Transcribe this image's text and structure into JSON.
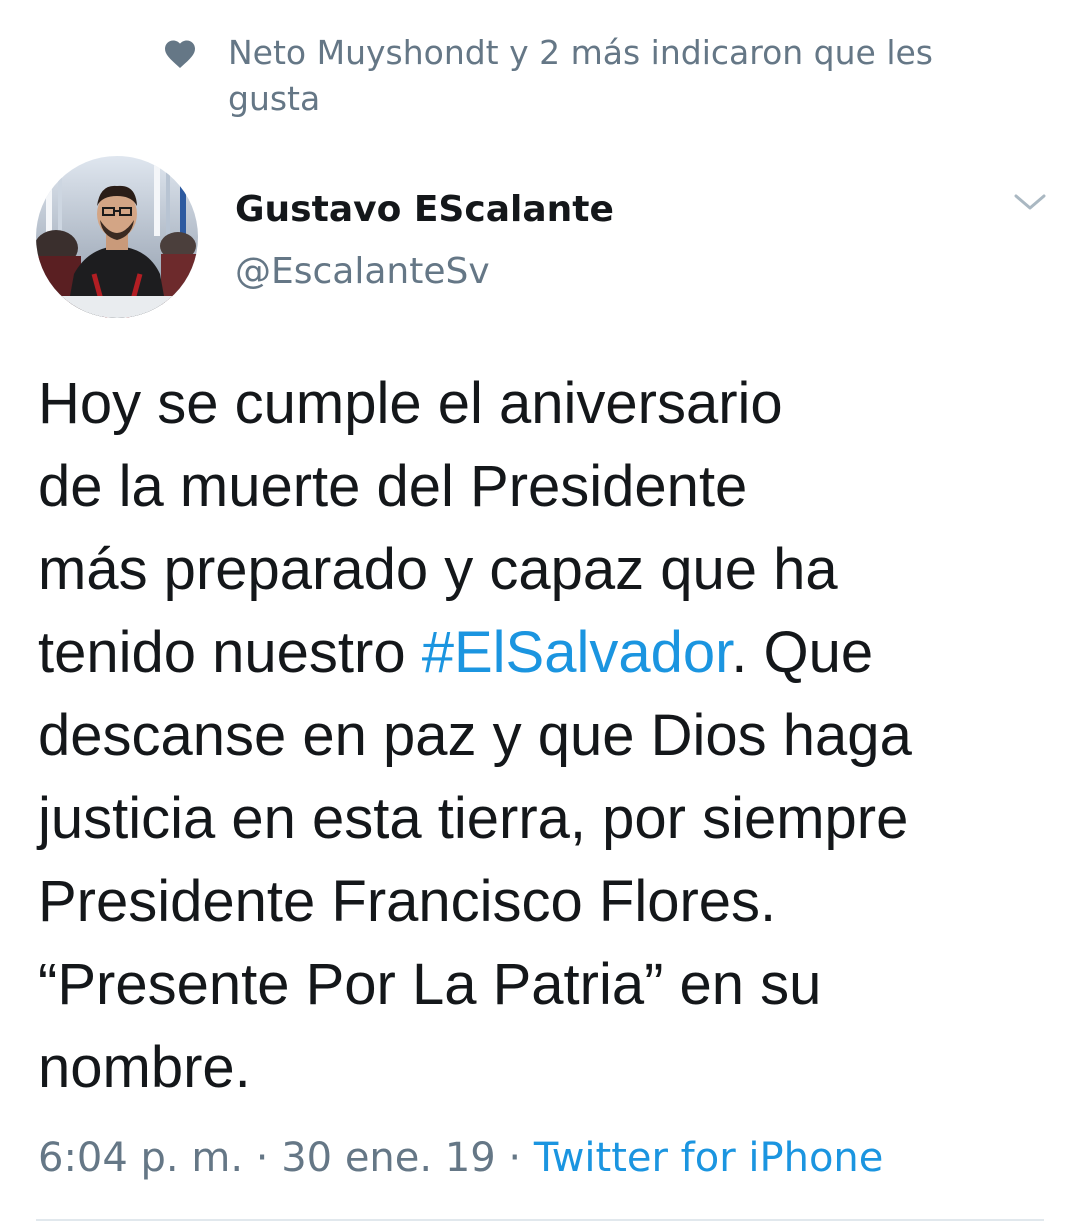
{
  "social_context": {
    "icon": "heart-icon",
    "text": "Neto Muyshondt y 2 más indicaron que les gusta"
  },
  "author": {
    "name": "Gustavo EScalante",
    "handle": "@EscalanteSv",
    "avatar": "avatar"
  },
  "tweet": {
    "line1": "Hoy se cumple el aniversario",
    "line2": "de la muerte del Presidente",
    "line3": "más preparado y capaz que ha",
    "line4_before": "tenido nuestro ",
    "hashtag": "#ElSalvador",
    "line4_after": ". Que",
    "line5": "descanse en paz y que Dios haga",
    "line6": "justicia en esta tierra, por siempre",
    "line7": "Presidente Francisco Flores.",
    "line8": "“Presente Por La Patria” en su",
    "line9": "nombre."
  },
  "meta": {
    "time": "6:04 p. m.",
    "separator1": " · ",
    "date": "30 ene. 19",
    "separator2": " · ",
    "source": "Twitter for iPhone"
  },
  "colors": {
    "link": "#1b95e0",
    "secondary": "#657786",
    "primary": "#14171a"
  }
}
